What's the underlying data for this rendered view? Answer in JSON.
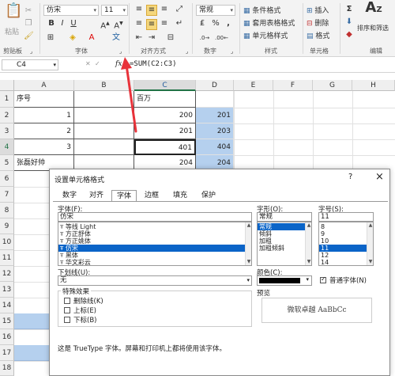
{
  "ribbon": {
    "paste_label": "粘贴",
    "clipboard_label": "剪贴板",
    "font_group_label": "字体",
    "align_group_label": "对齐方式",
    "number_group_label": "数字",
    "styles_group_label": "样式",
    "cells_group_label": "单元格",
    "edit_group_label": "编辑",
    "font_name": "仿宋",
    "font_size": "11",
    "number_format": "常规",
    "cond_format": "条件格式",
    "table_format": "套用表格格式",
    "cell_style": "单元格样式",
    "insert": "插入",
    "delete": "删除",
    "format": "格式",
    "sort_filter": "排序和筛选",
    "percent": "%",
    "comma": ","
  },
  "formula_bar": {
    "name_box": "C4",
    "formula": "=SUM(C2:C3)"
  },
  "sheet": {
    "columns": [
      "A",
      "B",
      "C",
      "D",
      "E",
      "F",
      "G",
      "H"
    ],
    "rows": [
      "1",
      "2",
      "3",
      "4",
      "5",
      "6",
      "7",
      "8",
      "9",
      "10",
      "11",
      "12",
      "13",
      "14",
      "15",
      "16",
      "17",
      "18"
    ],
    "a1": "序号",
    "c1": "百万",
    "a2": "1",
    "c2": "200",
    "d2": "201",
    "a3": "2",
    "c3": "201",
    "d3": "203",
    "a4": "3",
    "c4": "401",
    "d4": "404",
    "a5": "张磊好帅",
    "c5": "204",
    "d5": "204"
  },
  "dialog": {
    "title": "设置单元格格式",
    "help": "?",
    "close": "×",
    "tabs": [
      "数字",
      "对齐",
      "字体",
      "边框",
      "填充",
      "保护"
    ],
    "font_label": "字体(F):",
    "font_value": "仿宋",
    "font_list": [
      "等线 Light",
      "方正舒体",
      "方正姚体",
      "仿宋",
      "黑体",
      "华文彩云"
    ],
    "style_label": "字形(O):",
    "style_value": "常规",
    "style_list": [
      "常规",
      "倾斜",
      "加粗",
      "加粗倾斜"
    ],
    "size_label": "字号(S):",
    "size_value": "11",
    "size_list": [
      "8",
      "9",
      "10",
      "11",
      "12",
      "14"
    ],
    "underline_label": "下划线(U):",
    "underline_value": "无",
    "color_label": "颜色(C):",
    "normal_font_label": "普通字体(N)",
    "effects_label": "特殊效果",
    "strike_label": "删除线(K)",
    "super_label": "上标(E)",
    "sub_label": "下标(B)",
    "preview_label": "预览",
    "preview_text": "微软卓越  AaBbCc",
    "note": "这是 TrueType 字体。屏幕和打印机上都将使用该字体。"
  },
  "colors": {
    "selected_blue": "#b5d0ee",
    "arrow_red": "#e8323a",
    "excel_green": "#217346"
  }
}
